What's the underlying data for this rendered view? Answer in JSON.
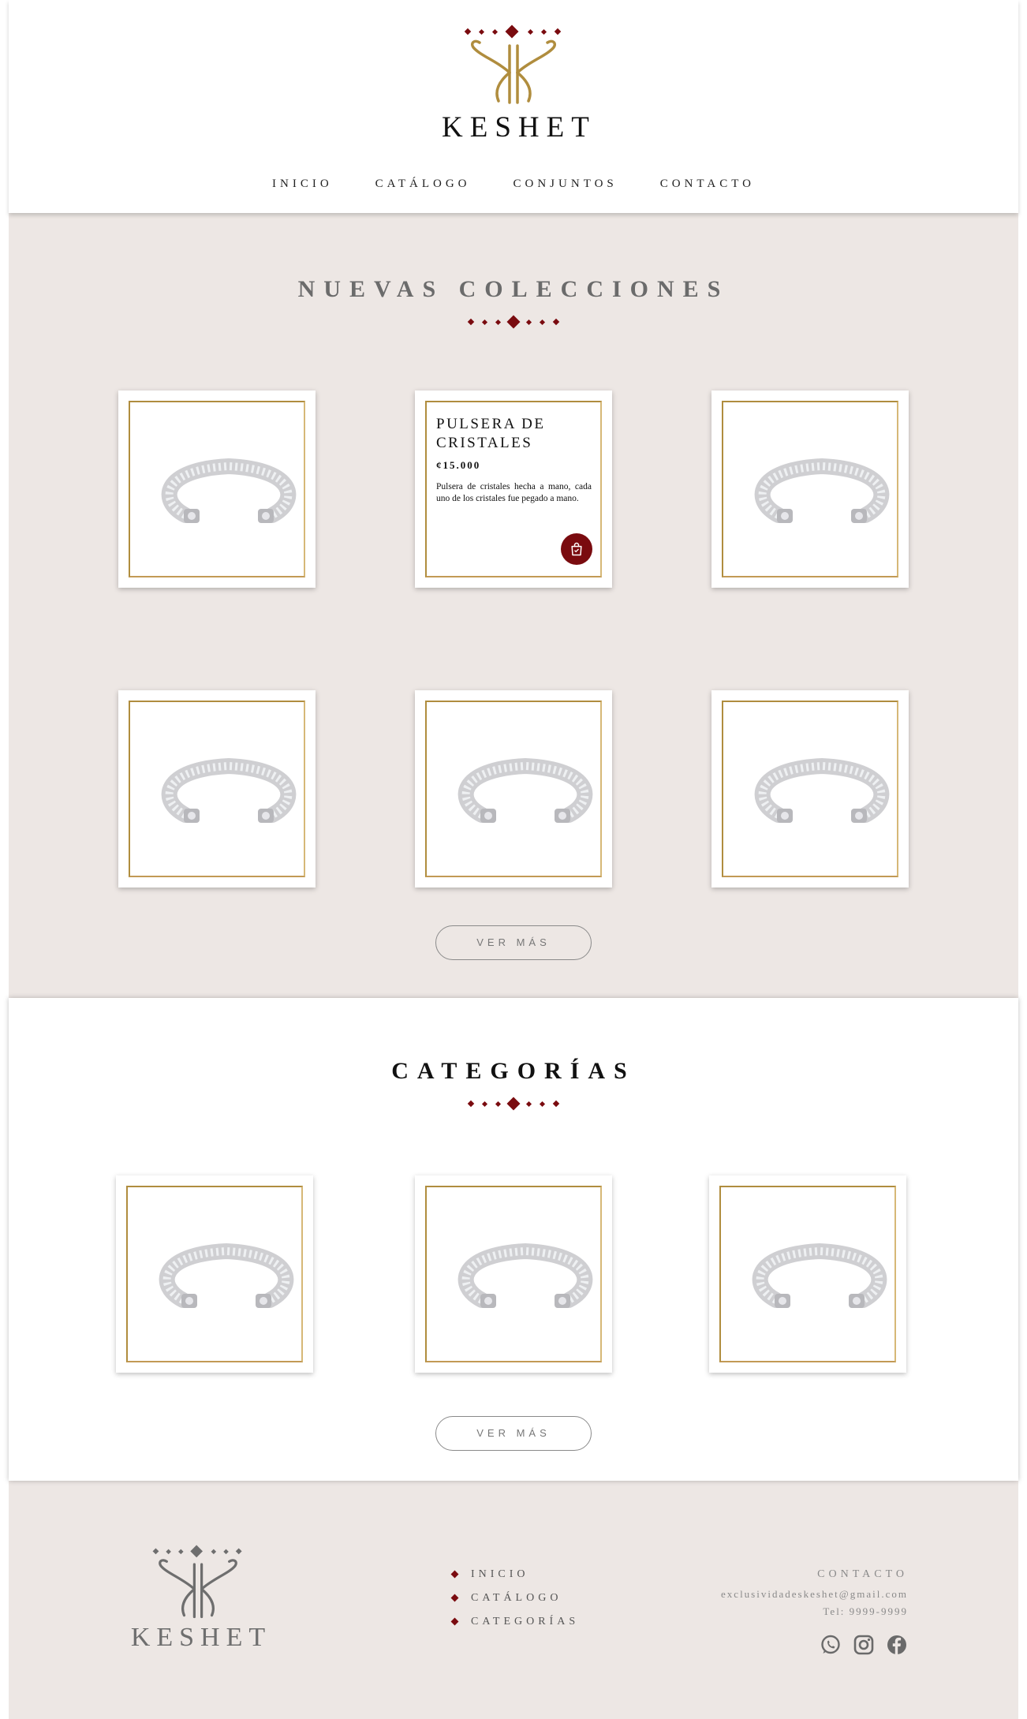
{
  "brand": {
    "name": "KESHET",
    "accent": "#7a0b0f",
    "gold": "#b08d3e",
    "background": "#ede7e4"
  },
  "nav": [
    {
      "label": "INICIO"
    },
    {
      "label": "CATÁLOGO"
    },
    {
      "label": "CONJUNTOS"
    },
    {
      "label": "CONTACTO"
    }
  ],
  "collections": {
    "title": "NUEVAS COLECCIONES",
    "featured": {
      "name_line1": "PULSERA DE",
      "name_line2": "CRISTALES",
      "price": "¢15.000",
      "description": "Pulsera de cristales hecha a mano, cada uno de los cristales fue pegado a mano.",
      "cart_icon": "shopping-bag-icon"
    },
    "more_label": "VER MÁS"
  },
  "categories": {
    "title": "CATEGORÍAS",
    "more_label": "VER MÁS"
  },
  "footer": {
    "brand": "KESHET",
    "links": [
      {
        "label": "INICIO"
      },
      {
        "label": "CATÁLOGO"
      },
      {
        "label": "CATEGORÍAS"
      }
    ],
    "contact_heading": "CONTACTO",
    "email": "exclusividadeskeshet@gmail.com",
    "phone": "Tel: 9999-9999",
    "socials": [
      "whatsapp-icon",
      "instagram-icon",
      "facebook-icon"
    ]
  }
}
